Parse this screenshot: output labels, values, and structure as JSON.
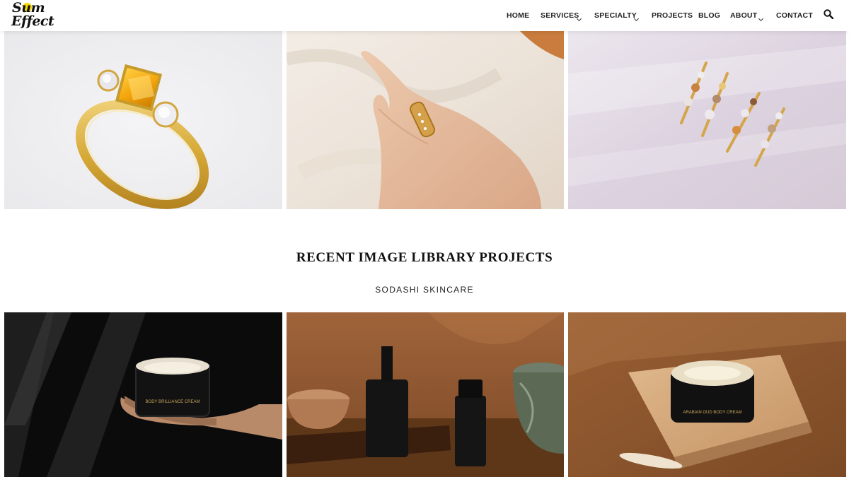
{
  "brand": {
    "logo_line1": "Sum",
    "logo_line2": "Effect",
    "accent_color": "#f5d800"
  },
  "nav": {
    "items": [
      {
        "label": "HOME",
        "dropdown": false
      },
      {
        "label": "SERVICES",
        "dropdown": true
      },
      {
        "label": "SPECIALTY",
        "dropdown": true
      },
      {
        "label": "PROJECTS",
        "dropdown": false
      },
      {
        "label": "BLOG",
        "dropdown": false
      },
      {
        "label": "ABOUT",
        "dropdown": true
      },
      {
        "label": "CONTACT",
        "dropdown": false
      }
    ],
    "search_icon": "search-icon"
  },
  "gallery_top": {
    "images": [
      {
        "subject": "yellow-diamond-three-stone-ring"
      },
      {
        "subject": "hand-wearing-gold-band"
      },
      {
        "subject": "gemstone-cuff-earrings"
      }
    ]
  },
  "section": {
    "title": "RECENT IMAGE LIBRARY PROJECTS",
    "subtitle": "SODASHI SKINCARE",
    "jar1_label": "BODY BRILLIANCE CREAM",
    "jar2_label": "ARABIAN OUD BODY CREAM"
  },
  "gallery_bottom": {
    "images": [
      {
        "subject": "hand-holding-cream-jar"
      },
      {
        "subject": "skincare-bottles-on-tray"
      },
      {
        "subject": "cream-jar-on-stone"
      }
    ]
  }
}
